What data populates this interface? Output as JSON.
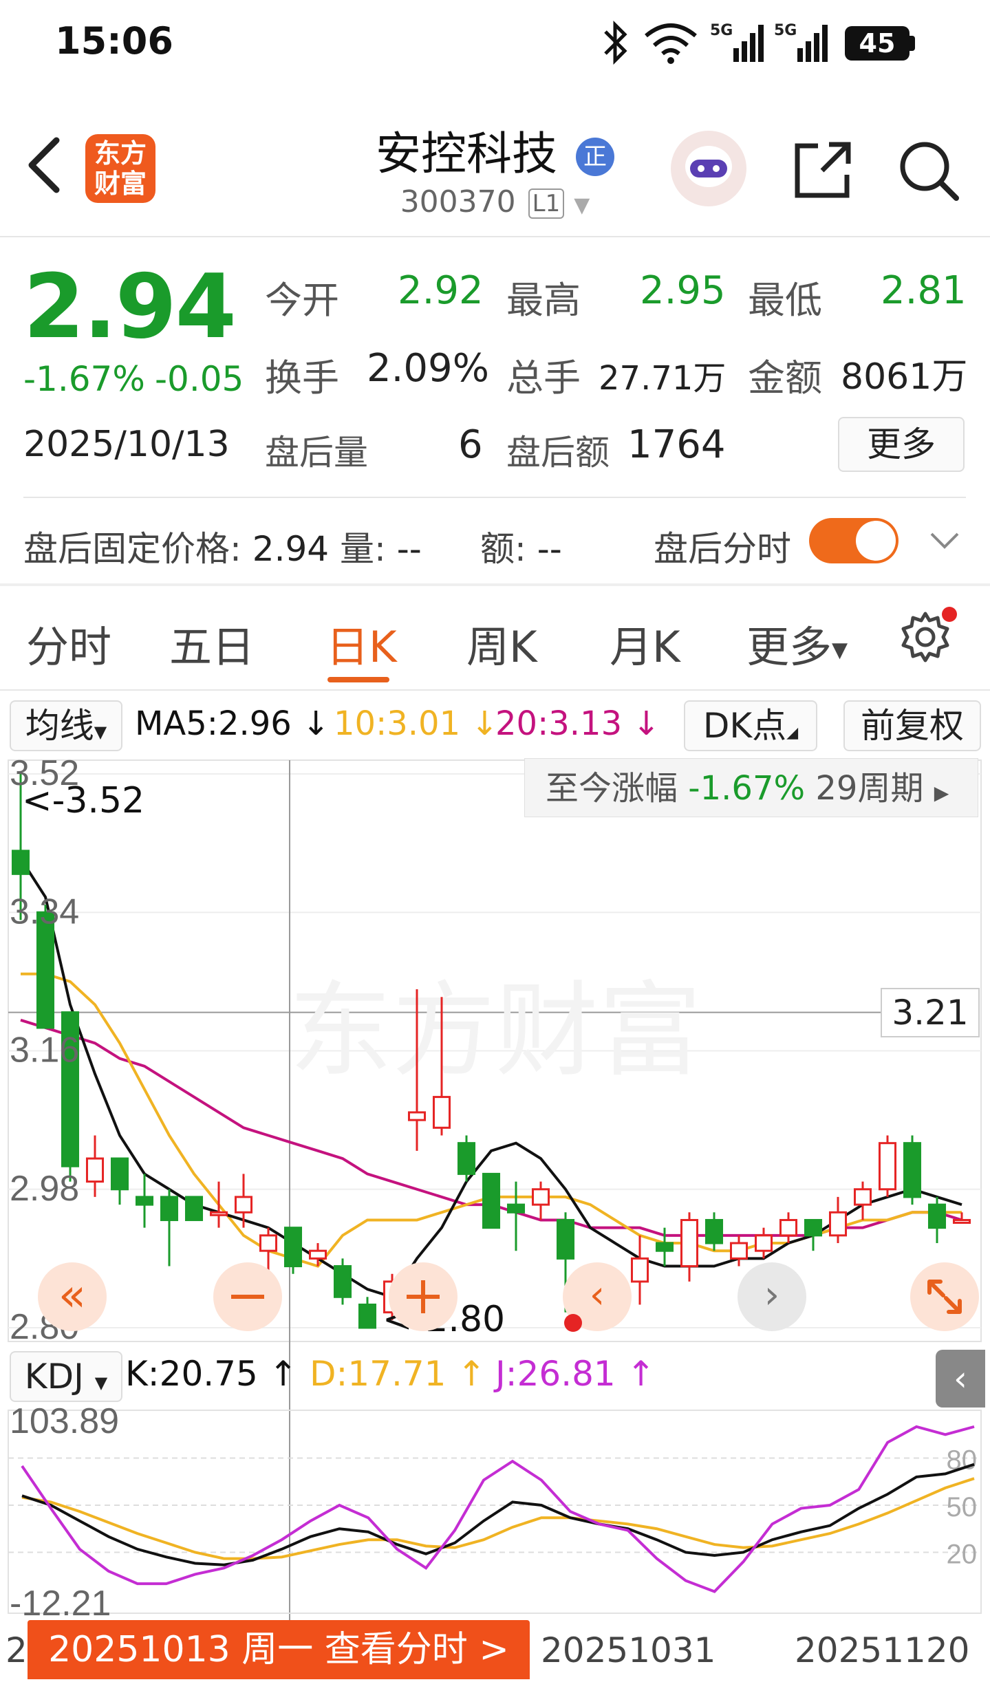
{
  "status_bar": {
    "time": "15:06",
    "battery": "45",
    "network_1": "5G",
    "network_2": "5G",
    "icons": [
      "bluetooth-icon",
      "wifi-icon",
      "signal-icon",
      "signal-icon",
      "battery-icon"
    ]
  },
  "header": {
    "back_icon": "chevron-left-icon",
    "app_logo_line1": "东方",
    "app_logo_line2": "财富",
    "title": "安控科技",
    "title_badge": "正",
    "code": "300370",
    "level": "L1",
    "share_icon": "share-icon",
    "search_icon": "search-icon",
    "assistant_icon": "robot-avatar-icon"
  },
  "quote": {
    "price": "2.94",
    "change_pct": "-1.67%",
    "change": "-0.05",
    "date": "2025/10/13",
    "open_label": "今开",
    "open": "2.92",
    "high_label": "最高",
    "high": "2.95",
    "low_label": "最低",
    "low": "2.81",
    "turnover_label": "换手",
    "turnover": "2.09%",
    "volume_label": "总手",
    "volume": "27.71万",
    "amount_label": "金额",
    "amount": "8061万",
    "after_vol_label": "盘后量",
    "after_vol": "6",
    "after_amt_label": "盘后额",
    "after_amt": "1764",
    "more_button": "更多"
  },
  "after_hours": {
    "fixed_price_label": "盘后固定价格:",
    "fixed_price": "2.94",
    "vol_label": "量:",
    "vol": "--",
    "amt_label": "额:",
    "amt": "--",
    "intraday_label": "盘后分时",
    "toggle_on": true
  },
  "tabs": {
    "items": [
      "分时",
      "五日",
      "日K",
      "周K",
      "月K",
      "更多"
    ],
    "active": "日K"
  },
  "indicator_bar": {
    "ma_select": "均线",
    "ma5": "MA5:2.96 ↓",
    "ma10": "10:3.01 ↓",
    "ma20": "20:3.13 ↓",
    "dk_button": "DK点",
    "adjust_button": "前复权"
  },
  "colors": {
    "up": "#e52424",
    "down": "#1a9b2b",
    "ma5": "#111111",
    "ma10": "#f0b323",
    "ma20": "#c4127e",
    "accent": "#e8601c"
  },
  "chart_labels": {
    "period_gain_label": "至今涨幅",
    "period_gain": "-1.67%",
    "period_count": "29周期",
    "max_label": "<-3.52",
    "min_label": "<-2.80",
    "crosshair_price": "3.21",
    "price_ticks": [
      "3.52",
      "3.34",
      "3.16",
      "2.98",
      "2.80"
    ],
    "kdj_select": "KDJ",
    "kdj_k": "K:20.75 ↑",
    "kdj_d": "D:17.71 ↑",
    "kdj_j": "J:26.81 ↑",
    "kdj_ticks": [
      "103.89",
      "-12.21"
    ],
    "kdj_right_ticks": [
      "80",
      "50",
      "20"
    ],
    "date_mid": "20251031",
    "date_right": "20251120",
    "date_left_partial": "2",
    "bottom_bar": "20251013 周一 查看分时 >",
    "watermark": "东方财富"
  },
  "chart_data": {
    "type": "candlestick",
    "ylim": [
      2.8,
      3.52
    ],
    "candles": [
      {
        "o": 3.42,
        "c": 3.39,
        "h": 3.52,
        "l": 3.33
      },
      {
        "o": 3.34,
        "c": 3.19,
        "h": 3.35,
        "l": 3.19
      },
      {
        "o": 3.21,
        "c": 3.01,
        "h": 3.21,
        "l": 2.99
      },
      {
        "o": 2.99,
        "c": 3.02,
        "h": 3.05,
        "l": 2.97
      },
      {
        "o": 3.02,
        "c": 2.98,
        "h": 3.02,
        "l": 2.96
      },
      {
        "o": 2.97,
        "c": 2.96,
        "h": 3.0,
        "l": 2.93
      },
      {
        "o": 2.97,
        "c": 2.94,
        "h": 2.98,
        "l": 2.88
      },
      {
        "o": 2.97,
        "c": 2.94,
        "h": 2.96,
        "l": 2.94
      },
      {
        "o": 2.95,
        "c": 2.95,
        "h": 2.99,
        "l": 2.93
      },
      {
        "o": 2.95,
        "c": 2.97,
        "h": 3.0,
        "l": 2.93
      },
      {
        "o": 2.9,
        "c": 2.92,
        "h": 2.93,
        "l": 2.81
      },
      {
        "o": 2.93,
        "c": 2.88,
        "h": 2.93,
        "l": 2.87
      },
      {
        "o": 2.89,
        "c": 2.9,
        "h": 2.91,
        "l": 2.88
      },
      {
        "o": 2.88,
        "c": 2.84,
        "h": 2.89,
        "l": 2.83
      },
      {
        "o": 2.83,
        "c": 2.8,
        "h": 2.84,
        "l": 2.8
      },
      {
        "o": 2.82,
        "c": 2.86,
        "h": 2.87,
        "l": 2.81
      },
      {
        "o": 3.07,
        "c": 3.08,
        "h": 3.24,
        "l": 3.03
      },
      {
        "o": 3.06,
        "c": 3.1,
        "h": 3.23,
        "l": 3.05
      },
      {
        "o": 3.04,
        "c": 3.0,
        "h": 3.05,
        "l": 2.99
      },
      {
        "o": 3.0,
        "c": 2.93,
        "h": 3.0,
        "l": 2.93
      },
      {
        "o": 2.96,
        "c": 2.95,
        "h": 2.99,
        "l": 2.9
      },
      {
        "o": 2.96,
        "c": 2.98,
        "h": 2.99,
        "l": 2.94
      },
      {
        "o": 2.94,
        "c": 2.89,
        "h": 2.95,
        "l": 2.82
      },
      {
        "o": 2.87,
        "c": 2.84,
        "h": 2.87,
        "l": 2.84
      },
      {
        "o": 2.83,
        "c": 2.86,
        "h": 2.87,
        "l": 2.82
      },
      {
        "o": 2.86,
        "c": 2.89,
        "h": 2.92,
        "l": 2.83
      },
      {
        "o": 2.91,
        "c": 2.9,
        "h": 2.93,
        "l": 2.88
      },
      {
        "o": 2.88,
        "c": 2.94,
        "h": 2.95,
        "l": 2.86
      },
      {
        "o": 2.94,
        "c": 2.91,
        "h": 2.95,
        "l": 2.9
      },
      {
        "o": 2.89,
        "c": 2.91,
        "h": 2.92,
        "l": 2.88
      },
      {
        "o": 2.9,
        "c": 2.92,
        "h": 2.93,
        "l": 2.89
      },
      {
        "o": 2.92,
        "c": 2.94,
        "h": 2.95,
        "l": 2.91
      },
      {
        "o": 2.94,
        "c": 2.92,
        "h": 2.94,
        "l": 2.9
      },
      {
        "o": 2.92,
        "c": 2.95,
        "h": 2.97,
        "l": 2.91
      },
      {
        "o": 2.96,
        "c": 2.98,
        "h": 2.99,
        "l": 2.94
      },
      {
        "o": 2.98,
        "c": 3.04,
        "h": 3.05,
        "l": 2.97
      },
      {
        "o": 3.04,
        "c": 2.97,
        "h": 3.05,
        "l": 2.96
      },
      {
        "o": 2.96,
        "c": 2.93,
        "h": 2.97,
        "l": 2.91
      },
      {
        "o": 2.94,
        "c": 2.94,
        "h": 2.95,
        "l": 2.94
      }
    ],
    "ma5": [
      3.41,
      3.36,
      3.22,
      3.13,
      3.05,
      3.0,
      2.98,
      2.96,
      2.95,
      2.94,
      2.93,
      2.91,
      2.89,
      2.87,
      2.85,
      2.84,
      2.89,
      2.93,
      2.99,
      3.03,
      3.04,
      3.02,
      2.98,
      2.93,
      2.91,
      2.89,
      2.88,
      2.88,
      2.88,
      2.89,
      2.89,
      2.91,
      2.92,
      2.94,
      2.96,
      2.97,
      2.98,
      2.97,
      2.96
    ],
    "ma10": [
      3.26,
      3.26,
      3.25,
      3.22,
      3.17,
      3.11,
      3.05,
      3.0,
      2.96,
      2.92,
      2.9,
      2.89,
      2.88,
      2.92,
      2.94,
      2.94,
      2.94,
      2.95,
      2.96,
      2.97,
      2.97,
      2.97,
      2.97,
      2.96,
      2.94,
      2.92,
      2.91,
      2.91,
      2.9,
      2.9,
      2.91,
      2.91,
      2.92,
      2.93,
      2.94,
      2.94,
      2.95,
      2.95,
      2.95
    ],
    "ma20": [
      3.2,
      3.19,
      3.18,
      3.17,
      3.15,
      3.14,
      3.12,
      3.1,
      3.08,
      3.06,
      3.05,
      3.04,
      3.03,
      3.02,
      3.0,
      2.99,
      2.98,
      2.97,
      2.96,
      2.96,
      2.95,
      2.94,
      2.94,
      2.93,
      2.93,
      2.93,
      2.92,
      2.92,
      2.92,
      2.92,
      2.92,
      2.92,
      2.92,
      2.93,
      2.93,
      2.94,
      2.95,
      2.95,
      2.94
    ],
    "kdj": {
      "ylim": [
        -12.21,
        103.89
      ],
      "k": [
        56,
        50,
        40,
        30,
        22,
        17,
        13,
        12,
        15,
        22,
        30,
        35,
        33,
        25,
        19,
        26,
        40,
        52,
        50,
        42,
        38,
        35,
        28,
        20,
        18,
        20,
        28,
        33,
        37,
        48,
        57,
        68,
        70,
        76
      ],
      "d": [
        55,
        52,
        46,
        39,
        32,
        26,
        20,
        16,
        16,
        17,
        21,
        25,
        28,
        28,
        24,
        23,
        28,
        36,
        42,
        42,
        40,
        38,
        35,
        30,
        25,
        23,
        24,
        28,
        32,
        38,
        45,
        53,
        61,
        67
      ],
      "j": [
        75,
        48,
        22,
        8,
        0,
        0,
        6,
        10,
        18,
        28,
        40,
        50,
        42,
        22,
        10,
        34,
        66,
        78,
        66,
        46,
        38,
        34,
        16,
        2,
        -5,
        14,
        38,
        48,
        50,
        60,
        90,
        100,
        95,
        100
      ]
    }
  }
}
